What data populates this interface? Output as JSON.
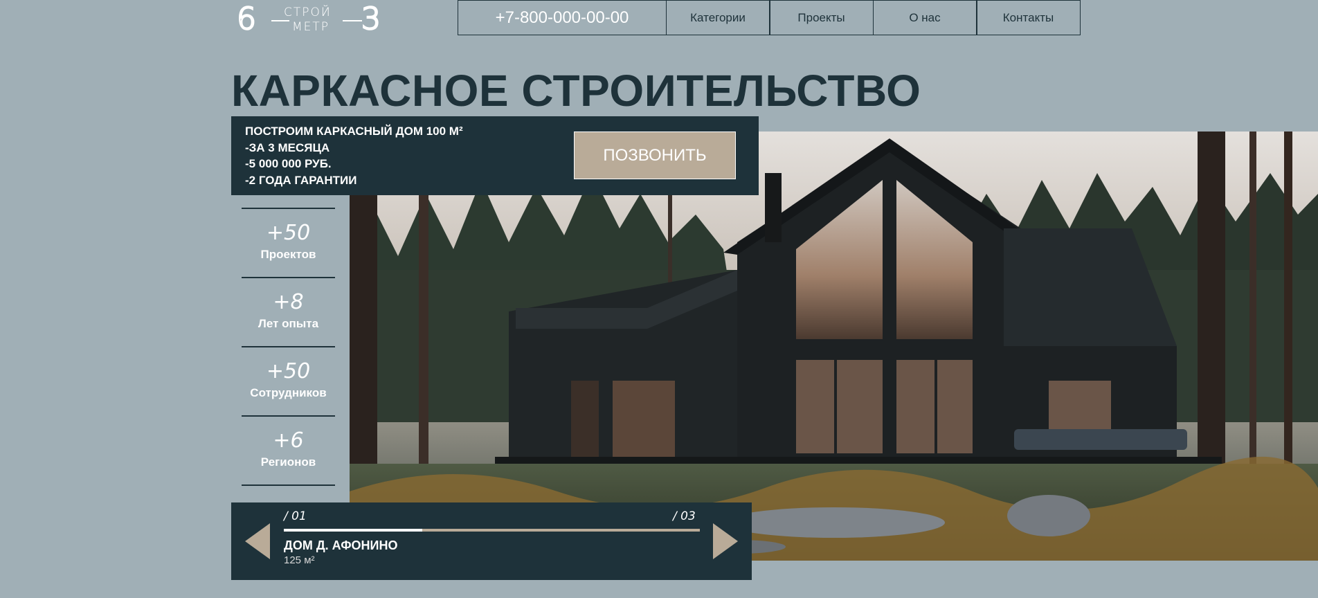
{
  "logo": {
    "left_digit": "6",
    "word_top": "СТРОЙ",
    "word_bottom": "МЕТР",
    "right_digit": "3"
  },
  "nav": {
    "phone": "+7-800-000-00-00",
    "links": [
      "Категории",
      "Проекты",
      "О нас",
      "Контакты"
    ]
  },
  "page_title": "КАРКАСНОЕ СТРОИТЕЛЬСТВО",
  "promo": {
    "lines": [
      "ПОСТРОИМ КАРКАСНЫЙ ДОМ 100 М²",
      "-ЗА 3 МЕСЯЦА",
      "-5 000 000 РУБ.",
      "-2 ГОДА ГАРАНТИИ"
    ],
    "button_label": "ПОЗВОНИТЬ"
  },
  "stats": [
    {
      "value": "+50",
      "label": "Проектов"
    },
    {
      "value": "+8",
      "label": "Лет опыта"
    },
    {
      "value": "+50",
      "label": "Сотрудников"
    },
    {
      "value": "+6",
      "label": "Регионов"
    }
  ],
  "slider": {
    "current": "/ 01",
    "total": "/ 03",
    "progress_fraction": 0.333,
    "name": "ДОМ Д. АФОНИНО",
    "area": "125 м²",
    "prev_icon": "triangle-left-icon",
    "next_icon": "triangle-right-icon"
  },
  "colors": {
    "background": "#a0afb6",
    "dark": "#1e323a",
    "accent": "#b9ab98"
  }
}
